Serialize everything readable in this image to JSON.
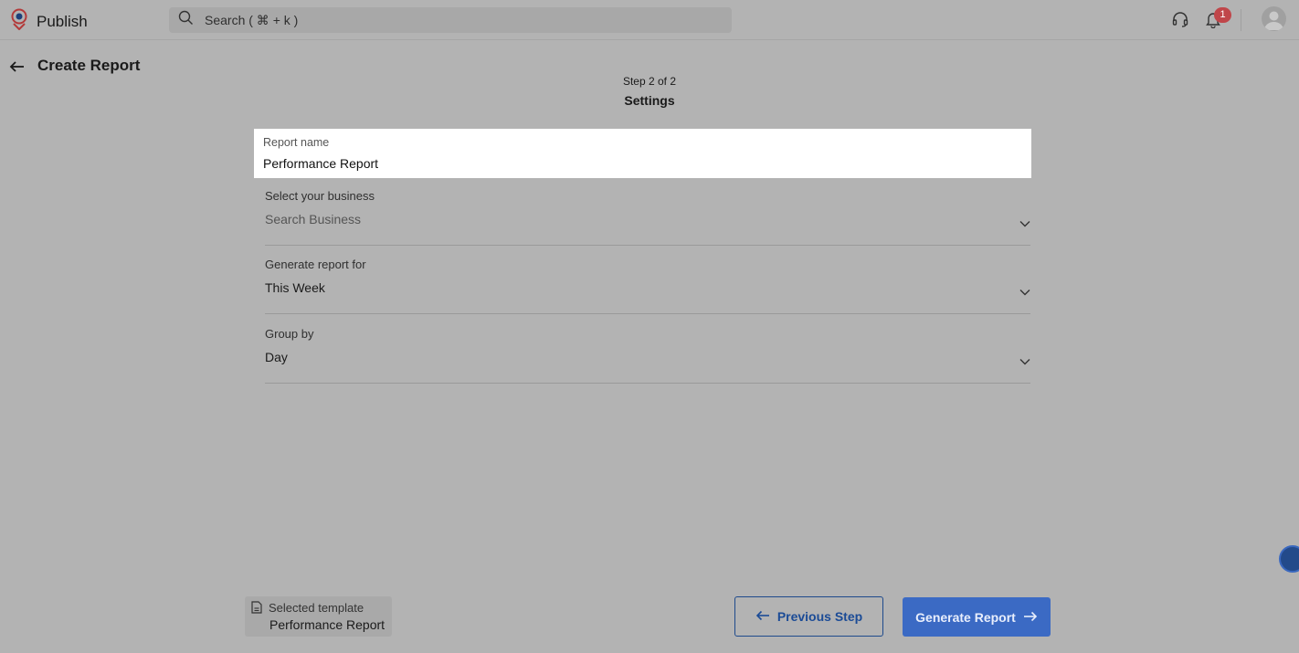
{
  "header": {
    "app_name": "Publish",
    "search_placeholder": "Search ( ⌘ + k )",
    "notification_count": "1",
    "icons": [
      "logo-icon",
      "search-icon",
      "headset-icon",
      "bell-icon",
      "avatar-icon"
    ]
  },
  "page": {
    "title": "Create Report",
    "step": "Step 2 of 2",
    "step_title": "Settings"
  },
  "form": {
    "report_name": {
      "label": "Report name",
      "value": "Performance Report"
    },
    "business": {
      "label": "Select your business",
      "placeholder": "Search Business"
    },
    "period": {
      "label": "Generate report for",
      "value": "This Week"
    },
    "group_by": {
      "label": "Group by",
      "value": "Day"
    }
  },
  "footer": {
    "template_label": "Selected template",
    "template_name": "Performance Report",
    "previous_label": "Previous Step",
    "generate_label": "Generate Report"
  },
  "colors": {
    "primary": "#3b6ac4",
    "overlay_bg": "#b3b3b3",
    "badge": "#c0464a"
  }
}
